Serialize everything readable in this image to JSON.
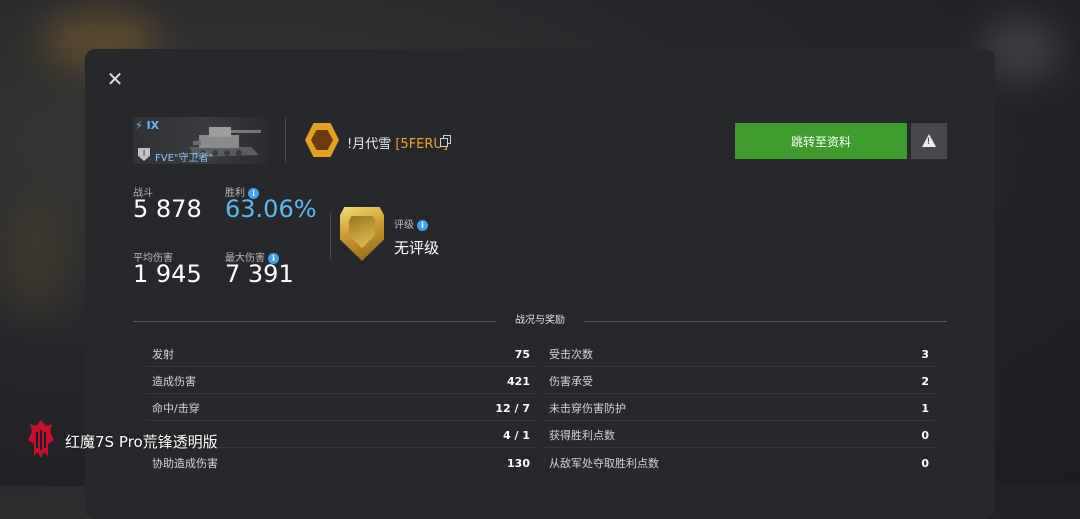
{
  "colors": {
    "accent_green": "#3e9c2f",
    "win_rate_blue": "#5bb8f5",
    "clan_tag_orange": "#f2a134",
    "info_blue": "#3ea3ea"
  },
  "dialog": {
    "close_icon": "close-icon"
  },
  "tank": {
    "tier": "IX",
    "name": "FVE\"守卫者\"",
    "badge_rank": "I"
  },
  "player": {
    "name": "!月代雪",
    "clan_tag": "[5FERU]"
  },
  "actions": {
    "go_to_profile": "跳转至资料",
    "report_icon": "warning-icon"
  },
  "stats": {
    "battles_label": "战斗",
    "battles_value": "5 878",
    "win_rate_label": "胜利",
    "win_rate_value": "63.06%",
    "avg_damage_label": "平均伤害",
    "avg_damage_value": "1 945",
    "max_damage_label": "最大伤害",
    "max_damage_value": "7 391"
  },
  "rating": {
    "label": "评级",
    "value": "无评级"
  },
  "section": {
    "title": "战况与奖励"
  },
  "battle_stats": {
    "left": [
      {
        "label": "发射",
        "value": "75"
      },
      {
        "label": "造成伤害",
        "value": "421"
      },
      {
        "label": "命中/击穿",
        "value": "12 / 7"
      },
      {
        "label": "",
        "value": "4 / 1"
      },
      {
        "label": "协助造成伤害",
        "value": "130"
      }
    ],
    "right": [
      {
        "label": "受击次数",
        "value": "3"
      },
      {
        "label": "伤害承受",
        "value": "2"
      },
      {
        "label": "未击穿伤害防护",
        "value": "1"
      },
      {
        "label": "获得胜利点数",
        "value": "0"
      },
      {
        "label": "从敌军处夺取胜利点数",
        "value": "0"
      }
    ]
  },
  "watermark": {
    "text": "红魔7S Pro荒锋透明版"
  }
}
